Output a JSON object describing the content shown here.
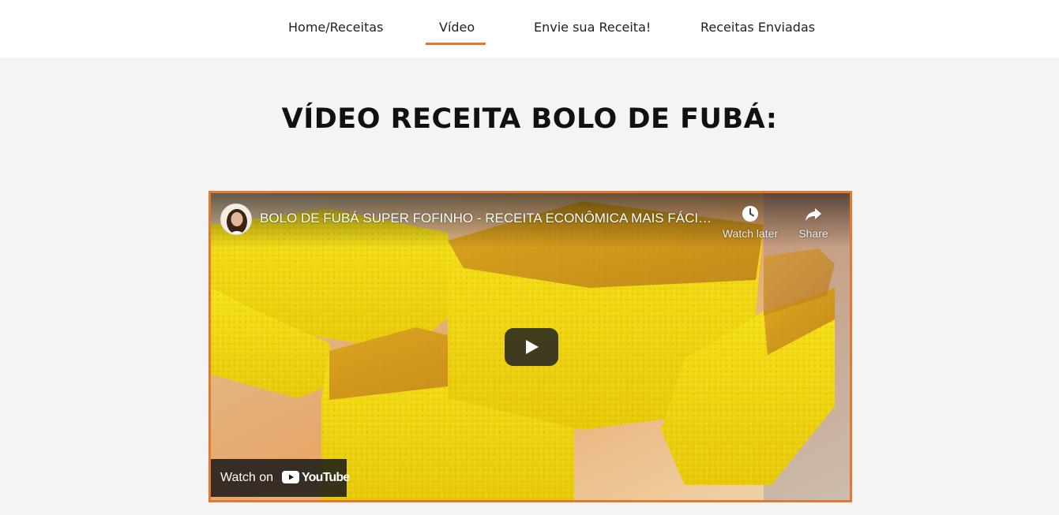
{
  "nav": {
    "items": [
      {
        "label": "Home/Receitas"
      },
      {
        "label": "Vídeo"
      },
      {
        "label": "Envie sua Receita!"
      },
      {
        "label": "Receitas Enviadas"
      }
    ],
    "active_index": 1,
    "accent_color": "#e07a2e"
  },
  "page": {
    "title": "VÍDEO RECEITA BOLO DE FUBÁ:"
  },
  "video": {
    "title": "BOLO DE FUBÁ SUPER FOFINHO - RECEITA ECONÔMICA MAIS FÁCIL DO MUNDO",
    "watch_later_label": "Watch later",
    "share_label": "Share",
    "watch_on_label": "Watch on",
    "youtube_wordmark": "YouTube",
    "icons": {
      "avatar": "channel-avatar",
      "watch_later": "clock-icon",
      "share": "share-arrow-icon",
      "play": "play-icon",
      "youtube": "youtube-logo-icon"
    }
  }
}
